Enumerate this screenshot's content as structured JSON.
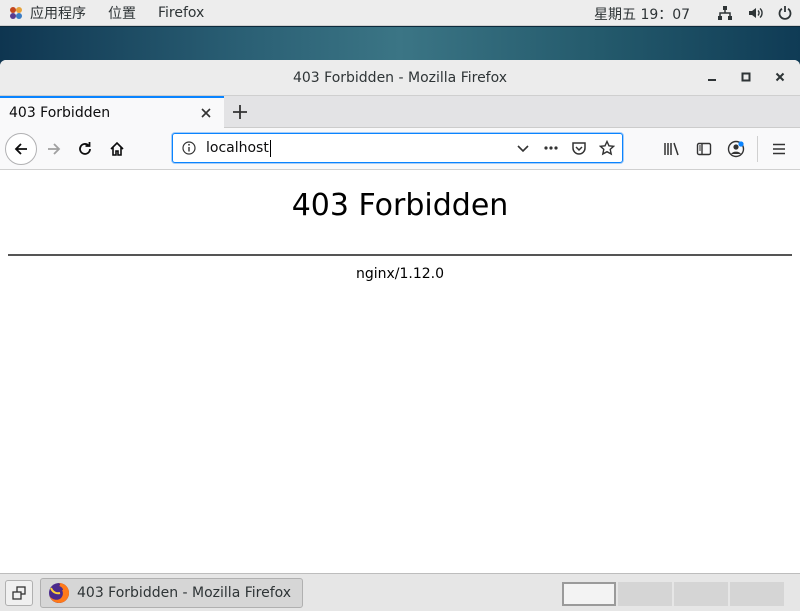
{
  "topbar": {
    "apps_menu": "应用程序",
    "places_menu": "位置",
    "app_name": "Firefox",
    "clock": "星期五 19：07",
    "tray_icons": [
      "network-icon",
      "volume-icon",
      "power-icon"
    ]
  },
  "window": {
    "title": "403 Forbidden - Mozilla Firefox",
    "controls": [
      "minimize-icon",
      "maximize-icon",
      "close-icon"
    ]
  },
  "tabs": [
    {
      "label": "403 Forbidden",
      "active": true
    }
  ],
  "toolbar": {
    "url": "localhost",
    "accent_color": "#0a84ff"
  },
  "page": {
    "heading": "403 Forbidden",
    "server": "nginx/1.12.0"
  },
  "taskbar": {
    "task_label": "403 Forbidden - Mozilla Firefox",
    "workspace_count": 4,
    "active_workspace": 1
  }
}
